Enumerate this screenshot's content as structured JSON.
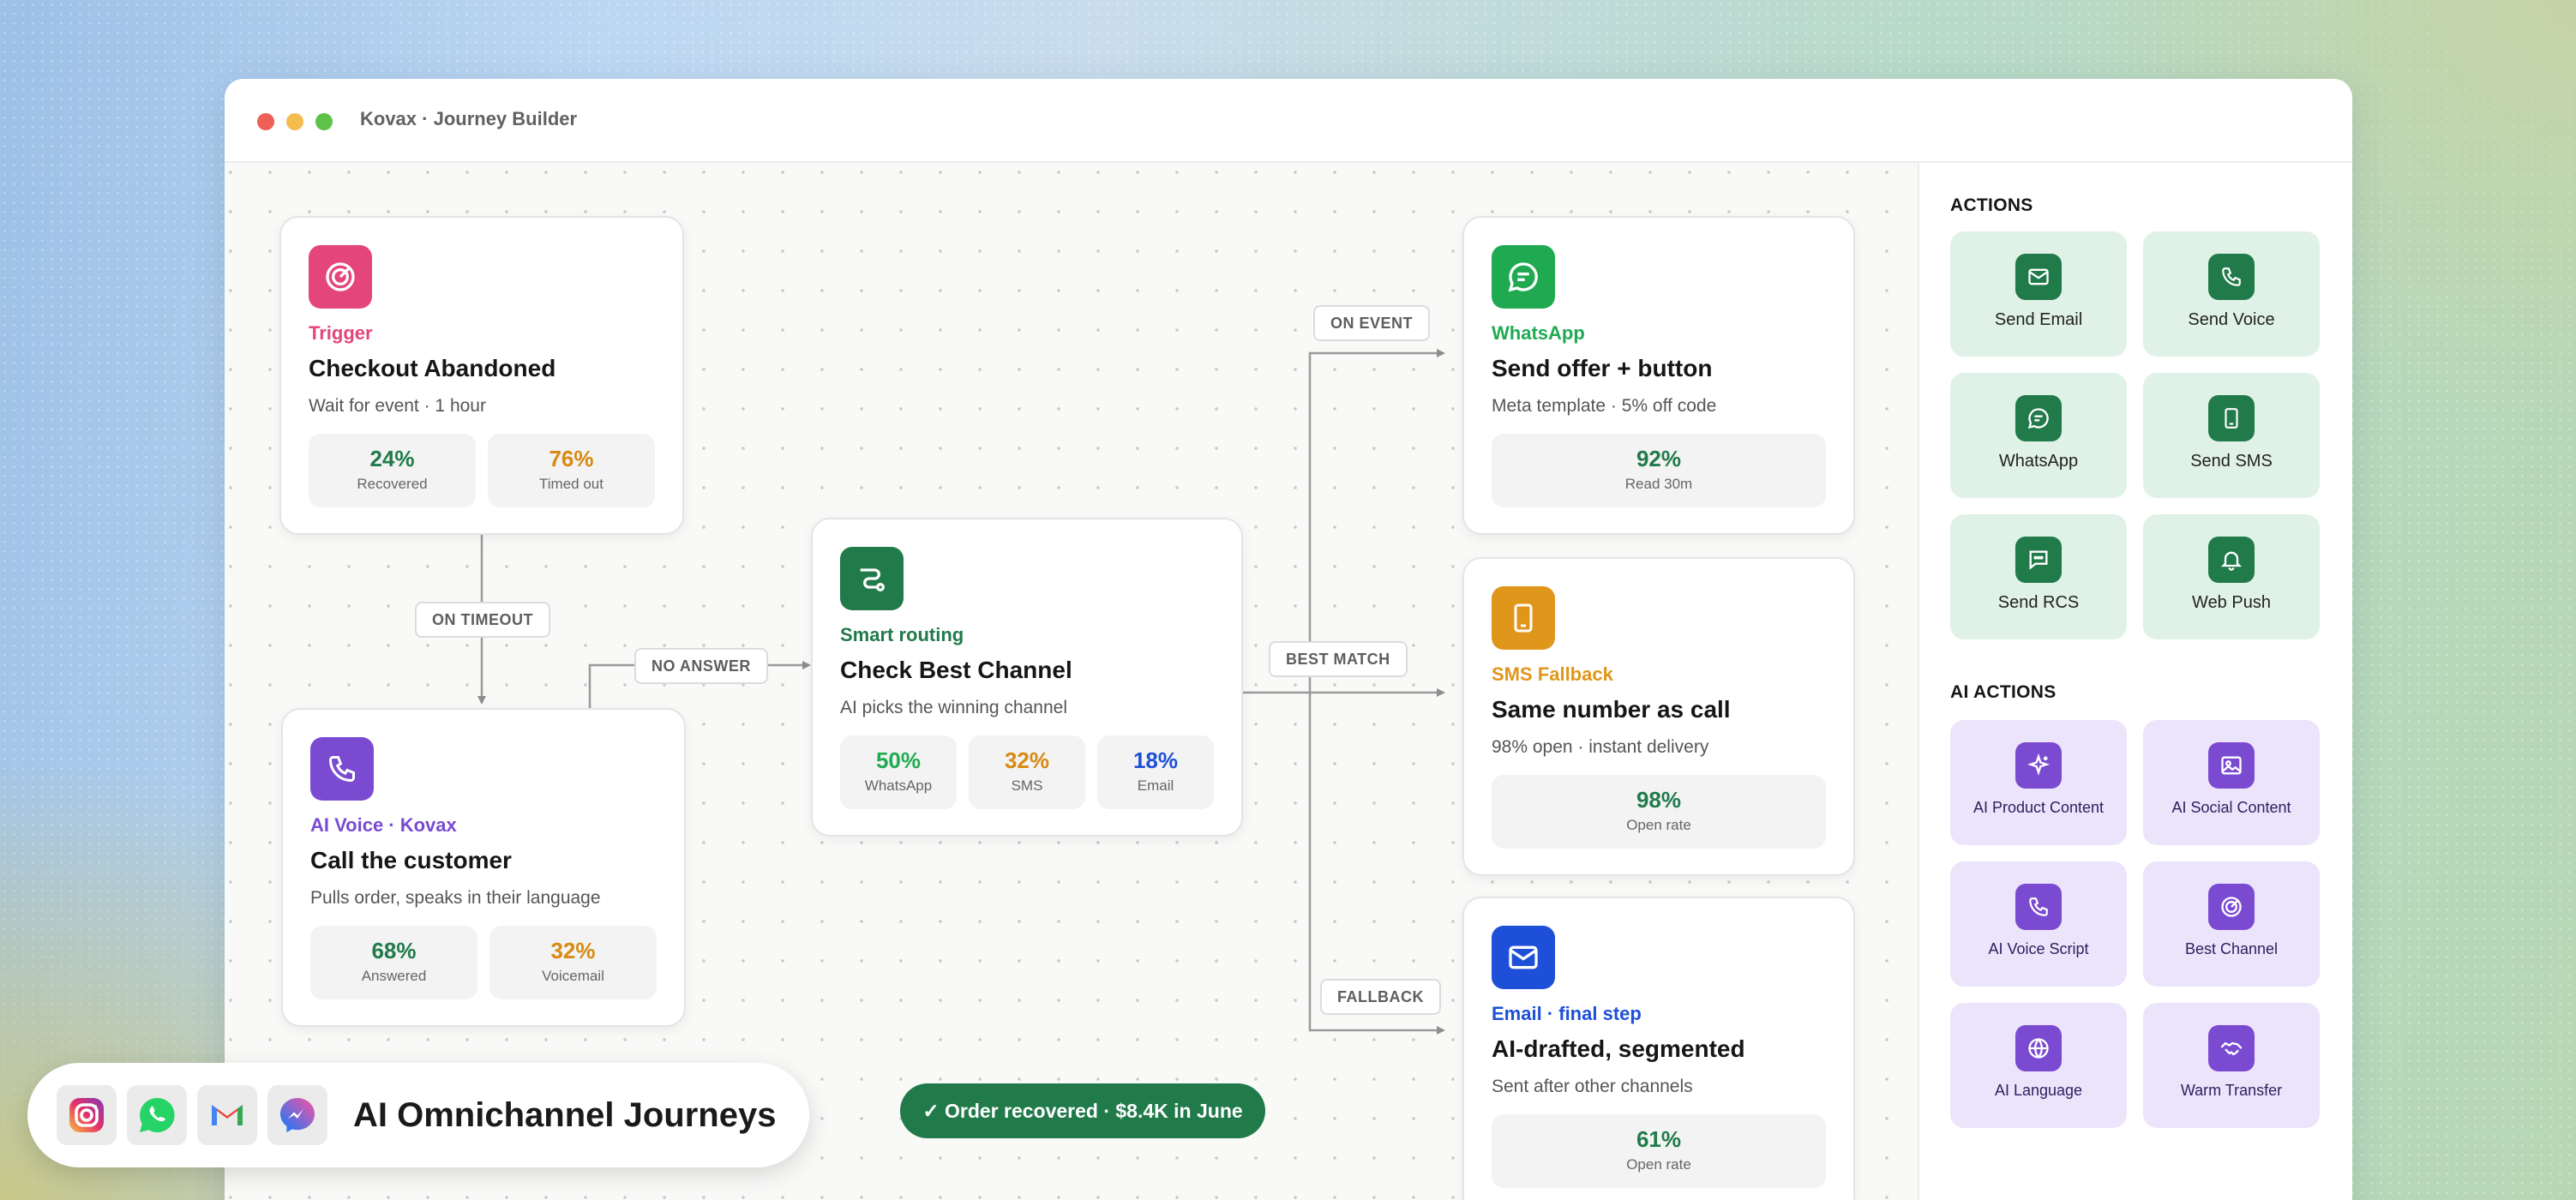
{
  "window": {
    "title": "Kovax · Journey Builder"
  },
  "nodes": {
    "trigger": {
      "kind": "Trigger",
      "icon": "target-icon",
      "color": "#e4457b",
      "title": "Checkout Abandoned",
      "subtitle": "Wait for event · 1 hour",
      "stats": [
        {
          "value": "24%",
          "label": "Recovered",
          "color": "#217a4a"
        },
        {
          "value": "76%",
          "label": "Timed out",
          "color": "#d88a12"
        }
      ]
    },
    "voice": {
      "kind": "AI Voice · Kovax",
      "icon": "phone-icon",
      "color": "#7a4bd1",
      "title": "Call the customer",
      "subtitle": "Pulls order, speaks in their language",
      "stats": [
        {
          "value": "68%",
          "label": "Answered",
          "color": "#217a4a"
        },
        {
          "value": "32%",
          "label": "Voicemail",
          "color": "#d88a12"
        }
      ]
    },
    "routing": {
      "kind": "Smart routing",
      "icon": "route-icon",
      "color": "#217a4a",
      "title": "Check Best Channel",
      "subtitle": "AI picks the winning channel",
      "stats": [
        {
          "value": "50%",
          "label": "WhatsApp",
          "color": "#1faa52"
        },
        {
          "value": "32%",
          "label": "SMS",
          "color": "#d88a12"
        },
        {
          "value": "18%",
          "label": "Email",
          "color": "#1e4fd8"
        }
      ]
    },
    "whatsapp": {
      "kind": "WhatsApp",
      "icon": "chat-bubble-icon",
      "color": "#1faa52",
      "title": "Send offer + button",
      "subtitle": "Meta template · 5% off code",
      "stats": [
        {
          "value": "92%",
          "label": "Read 30m",
          "color": "#217a4a"
        }
      ]
    },
    "sms": {
      "kind": "SMS Fallback",
      "icon": "mobile-phone-icon",
      "color": "#e0961a",
      "title": "Same number as call",
      "subtitle": "98% open · instant delivery",
      "stats": [
        {
          "value": "98%",
          "label": "Open rate",
          "color": "#217a4a"
        }
      ]
    },
    "email": {
      "kind": "Email · final step",
      "icon": "envelope-icon",
      "color": "#1e4fd8",
      "title": "AI-drafted, segmented",
      "subtitle": "Sent after other channels",
      "stats": [
        {
          "value": "61%",
          "label": "Open rate",
          "color": "#217a4a"
        }
      ]
    }
  },
  "edges": {
    "on_timeout": "ON TIMEOUT",
    "no_answer": "NO ANSWER",
    "on_event": "ON EVENT",
    "best_match": "BEST MATCH",
    "fallback": "FALLBACK"
  },
  "status": {
    "text": "✓ Order recovered · $8.4K in June"
  },
  "brand": {
    "title": "AI Omnichannel Journeys",
    "icons": [
      "instagram-icon",
      "whatsapp-icon",
      "gmail-icon",
      "messenger-icon"
    ]
  },
  "panel": {
    "actions_title": "ACTIONS",
    "actions": [
      {
        "label": "Send Email",
        "icon": "envelope-icon"
      },
      {
        "label": "Send Voice",
        "icon": "phone-icon"
      },
      {
        "label": "WhatsApp",
        "icon": "chat-bubble-icon"
      },
      {
        "label": "Send SMS",
        "icon": "mobile-phone-icon"
      },
      {
        "label": "Send RCS",
        "icon": "message-dots-icon"
      },
      {
        "label": "Web Push",
        "icon": "bell-icon"
      }
    ],
    "ai_actions_title": "AI ACTIONS",
    "ai_actions": [
      {
        "label": "AI Product Content",
        "icon": "sparkle-icon"
      },
      {
        "label": "AI Social Content",
        "icon": "image-icon"
      },
      {
        "label": "AI Voice Script",
        "icon": "phone-icon"
      },
      {
        "label": "Best Channel",
        "icon": "target-icon"
      },
      {
        "label": "AI Language",
        "icon": "globe-icon"
      },
      {
        "label": "Warm Transfer",
        "icon": "handshake-icon"
      }
    ]
  }
}
